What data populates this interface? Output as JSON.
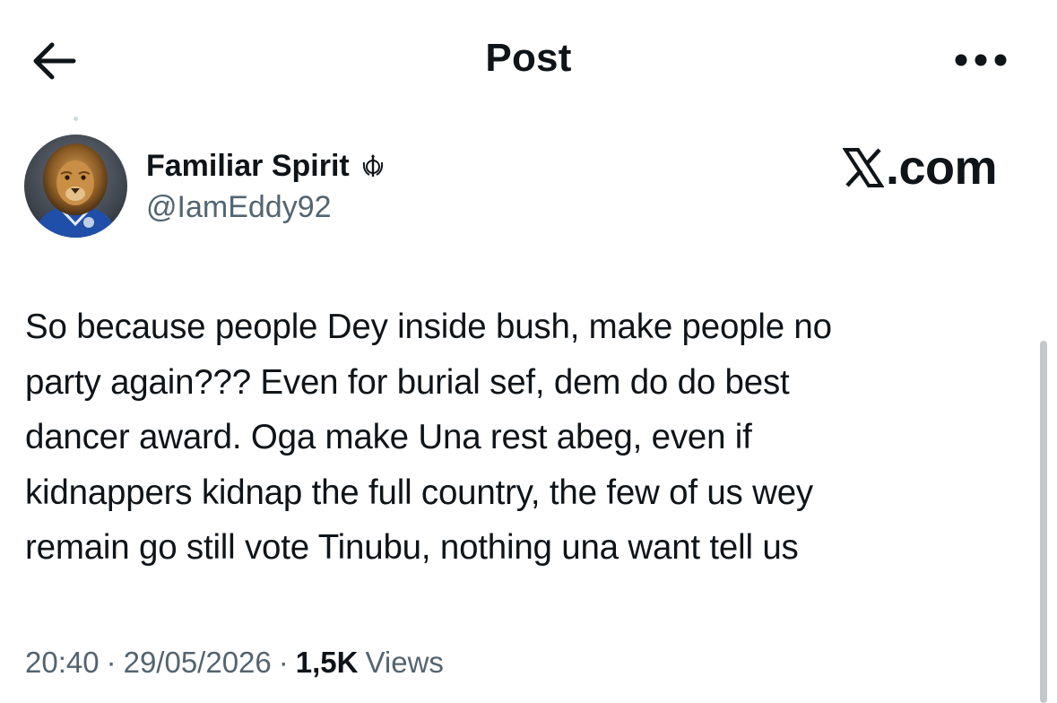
{
  "header": {
    "title": "Post",
    "back_icon": "arrow-left-icon",
    "more_icon": "more-horizontal-icon"
  },
  "author": {
    "name": "Familiar Spirit",
    "handle": "@IamEddy92",
    "badge_icon": "khanda-icon",
    "avatar_icon": "lion-avatar"
  },
  "watermark": {
    "suffix": ".com",
    "logo_icon": "x-logo-icon"
  },
  "tweet": {
    "text": "So because people Dey inside bush, make people no\nparty again??? Even for burial sef, dem do do best\ndancer award. Oga make Una rest abeg, even if\nkidnappers kidnap the full country, the few of us wey\nremain go still vote Tinubu, nothing una want tell us"
  },
  "meta": {
    "time": "20:40",
    "separator": "·",
    "date": "29/05/2026",
    "views_count": "1,5K",
    "views_label": "Views"
  },
  "colors": {
    "text": "#0f1419",
    "secondary": "#536471",
    "background": "#ffffff"
  }
}
